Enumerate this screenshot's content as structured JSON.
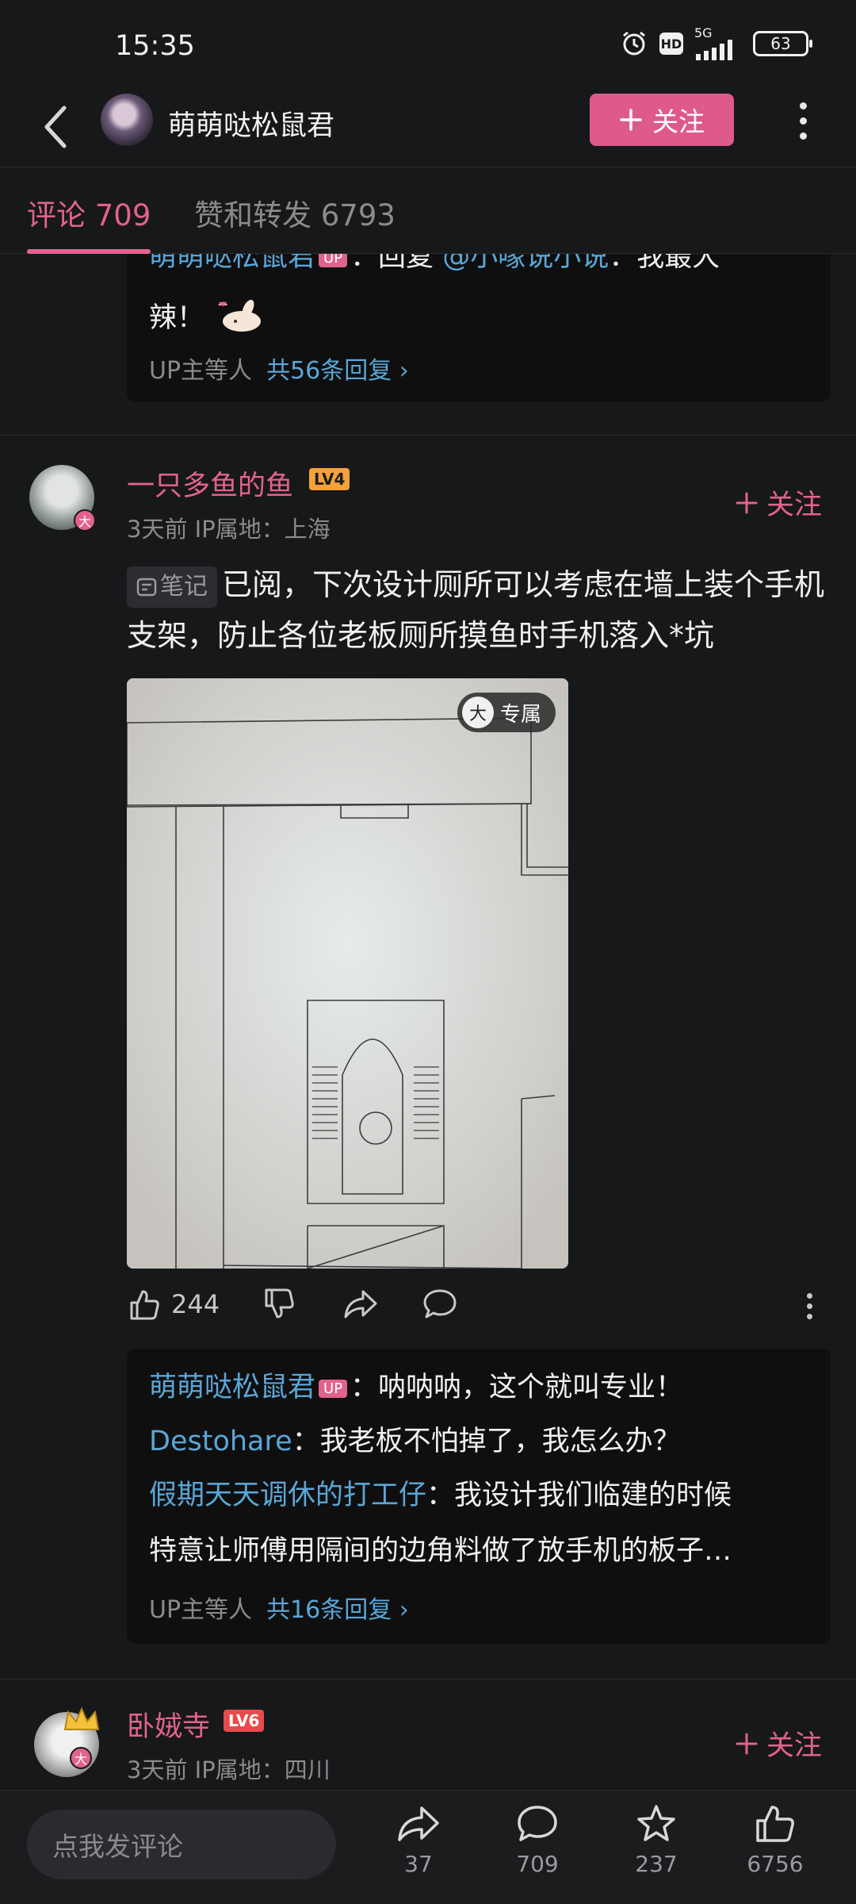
{
  "status": {
    "time": "15:35",
    "network": "5G",
    "hd": "HD",
    "battery": "63"
  },
  "header": {
    "title": "萌萌哒松鼠君",
    "follow_label": "关注"
  },
  "tabs": {
    "comments": "评论 709",
    "likes": "赞和转发 6793"
  },
  "prev_reply": {
    "line1_name": "萌萌哒松鼠君",
    "line1_mid": "：回复 ",
    "line1_mention": "@小喙说小说",
    "line1_tail": "：我最大",
    "line2": "辣！",
    "meta_label": "UP主等人",
    "meta_count": "共56条回复 ›"
  },
  "comment1": {
    "username": "一只多鱼的鱼",
    "level": "LV4",
    "vip": "大",
    "meta": "3天前  IP属地：上海",
    "follow_label": "关注",
    "note_chip": "笔记",
    "text": "已阅，下次设计厕所可以考虑在墙上装个手机支架，防止各位老板厕所摸鱼时手机落入*坑",
    "image_badge": "专属",
    "image_badge_icon": "大",
    "likes": "244",
    "replies": [
      {
        "name": "萌萌哒松鼠君",
        "up": "UP",
        "text": "：呐呐呐，这个就叫专业！"
      },
      {
        "name": "Destohare",
        "text": "：我老板不怕掉了，我怎么办？"
      },
      {
        "name": "假期天天调休的打工仔",
        "text": "：我设计我们临建的时候"
      },
      {
        "text": "特意让师傅用隔间的边角料做了放手机的板子…"
      }
    ],
    "reply_meta_label": "UP主等人",
    "reply_meta_count": "共16条回复 ›"
  },
  "comment2": {
    "username": "卧娀寺",
    "level": "LV6",
    "vip": "大",
    "meta": "3天前  IP属地：四川",
    "follow_label": "关注"
  },
  "bottom": {
    "input_placeholder": "点我发评论",
    "share_count": "37",
    "comment_count": "709",
    "favorite_count": "237",
    "like_count": "6756"
  }
}
